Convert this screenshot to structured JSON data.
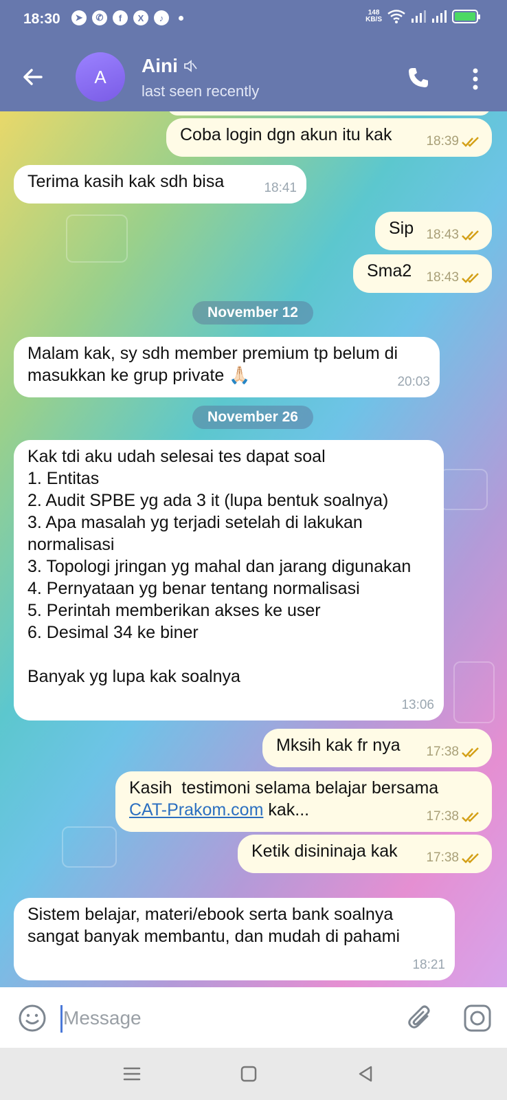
{
  "status_bar": {
    "time": "18:30",
    "app_icons": [
      "telegram-icon",
      "whatsapp-icon",
      "facebook-icon",
      "x-icon",
      "tiktok-icon"
    ],
    "net_speed_value": "148",
    "net_speed_unit": "KB/S",
    "battery_color": "#4cd964"
  },
  "header": {
    "avatar_letter": "A",
    "contact_name": "Aini",
    "status": "last seen recently",
    "bg_color": "#6778ad"
  },
  "messages": [
    {
      "dir": "out",
      "text": "Coba login dgn akun itu kak",
      "time": "18:39",
      "read": true
    },
    {
      "dir": "in",
      "text": "Terima kasih kak sdh bisa",
      "time": "18:41"
    },
    {
      "dir": "out",
      "text": "Sip",
      "time": "18:43",
      "read": true
    },
    {
      "dir": "out",
      "text": "Sma2",
      "time": "18:43",
      "read": true
    },
    {
      "date": "November 12"
    },
    {
      "dir": "in",
      "text": "Malam kak, sy sdh member premium tp belum di masukkan ke grup private 🙏🏻",
      "time": "20:03"
    },
    {
      "date": "November 26"
    },
    {
      "dir": "in",
      "text": "Kak tdi aku udah selesai tes dapat soal\n1. Entitas\n2. Audit SPBE yg ada 3 it (lupa bentuk soalnya)\n3. Apa masalah yg terjadi setelah di lakukan normalisasi\n3. Topologi jringan yg mahal dan jarang digunakan\n4. Pernyataan yg benar tentang normalisasi\n5. Perintah memberikan akses ke user\n6. Desimal 34 ke biner\n\nBanyak yg lupa kak soalnya",
      "time": "13:06"
    },
    {
      "dir": "out",
      "text": "Mksih kak fr nya",
      "time": "17:38",
      "read": true
    },
    {
      "dir": "out",
      "text": "Kasih  testimoni selama belajar bersama",
      "link": "CAT-Prakom.com",
      "text_after": " kak...",
      "time": "17:38",
      "read": true
    },
    {
      "dir": "out",
      "text": "Ketik disininaja kak",
      "time": "17:38",
      "read": true
    },
    {
      "dir": "in",
      "text": "Sistem belajar, materi/ebook serta bank soalnya sangat banyak membantu, dan mudah di pahami",
      "time": "18:21"
    }
  ],
  "input": {
    "placeholder": "Message"
  },
  "nav": [
    "menu-icon",
    "home-icon",
    "back-triangle-icon"
  ]
}
